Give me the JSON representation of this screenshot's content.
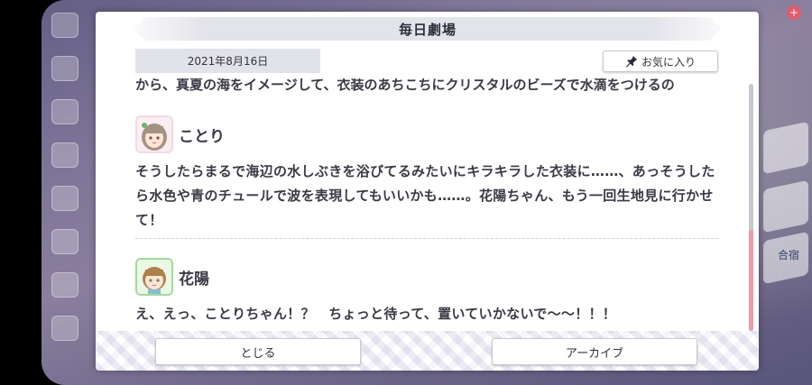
{
  "modal": {
    "title": "毎日劇場",
    "date": "2021年8月16日",
    "favorite_label": "お気に入り",
    "partial_line": "から、真夏の海をイメージして、衣装のあちこちにクリスタルのビーズで水滴をつけるの",
    "dialogs": [
      {
        "speaker": "ことり",
        "text": "そうしたらまるで海辺の水しぶきを浴びてるみたいにキラキラした衣装に……、あっそうしたら水色や青のチュールで波を表現してもいいかも……。花陽ちゃん、もう一回生地見に行かせて！"
      },
      {
        "speaker": "花陽",
        "text": "え、えっ、ことりちゃん！？　ちょっと待って、置いていかないで〜〜！！！"
      }
    ],
    "close_label": "とじる",
    "archive_label": "アーカイブ"
  },
  "background": {
    "right_label": "合宿"
  },
  "colors": {
    "scroll_thumb": "#ef9aa8",
    "accent_pink": "#e35b6a"
  }
}
